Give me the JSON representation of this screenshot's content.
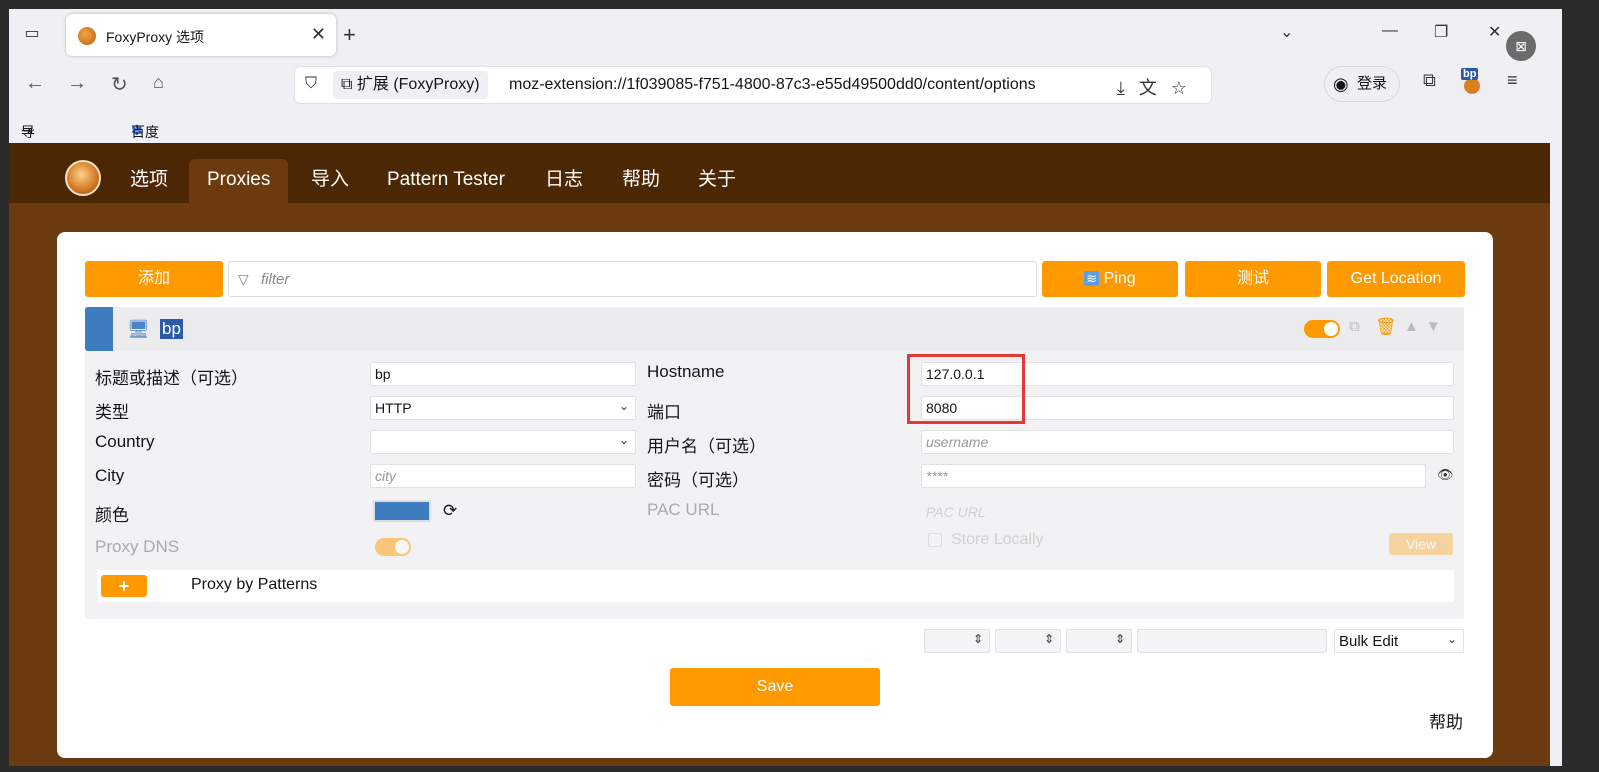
{
  "browser": {
    "tab_title": "FoxyProxy 选项",
    "new_tab_symbol": "+",
    "url_chip": "扩展 (FoxyProxy)",
    "url": "moz-extension://1f039085-f751-4800-87c3-e55d49500dd0/content/options",
    "login_label": "登录",
    "bookmarks": [
      "导入书签...",
      "百度一下，你就知道"
    ],
    "bp_ext_label": "bp"
  },
  "nav": {
    "items": [
      "选项",
      "Proxies",
      "导入",
      "Pattern Tester",
      "日志",
      "帮助",
      "关于"
    ],
    "active": "Proxies"
  },
  "toolbar": {
    "add_label": "添加",
    "filter_placeholder": "filter",
    "ping_label": "Ping",
    "test_label": "测试",
    "get_location_label": "Get Location"
  },
  "proxy": {
    "name": "bp",
    "enabled": true,
    "fields": {
      "title_label": "标题或描述（可选）",
      "title_value": "bp",
      "type_label": "类型",
      "type_value": "HTTP",
      "country_label": "Country",
      "country_value": "",
      "city_label": "City",
      "city_placeholder": "city",
      "color_label": "颜色",
      "color_value": "#3d7cbf",
      "proxy_dns_label": "Proxy DNS",
      "hostname_label": "Hostname",
      "hostname_value": "127.0.0.1",
      "port_label": "端口",
      "port_value": "8080",
      "username_label": "用户名（可选）",
      "username_placeholder": "username",
      "password_label": "密码（可选）",
      "password_placeholder": "****",
      "pac_url_label": "PAC URL",
      "pac_url_placeholder": "PAC URL",
      "store_locally_label": "Store Locally",
      "view_label": "View"
    },
    "pattern_add_label": "+",
    "pattern_label": "Proxy by Patterns"
  },
  "bulk": {
    "bulk_edit_label": "Bulk Edit"
  },
  "footer": {
    "save_label": "Save",
    "help_label": "帮助"
  },
  "colors": {
    "accent": "#ff9900",
    "nav_bg": "#4c2704",
    "page_bg": "#6b3b0f",
    "proxy_color": "#3d7cbf",
    "highlight": "#e53935"
  }
}
